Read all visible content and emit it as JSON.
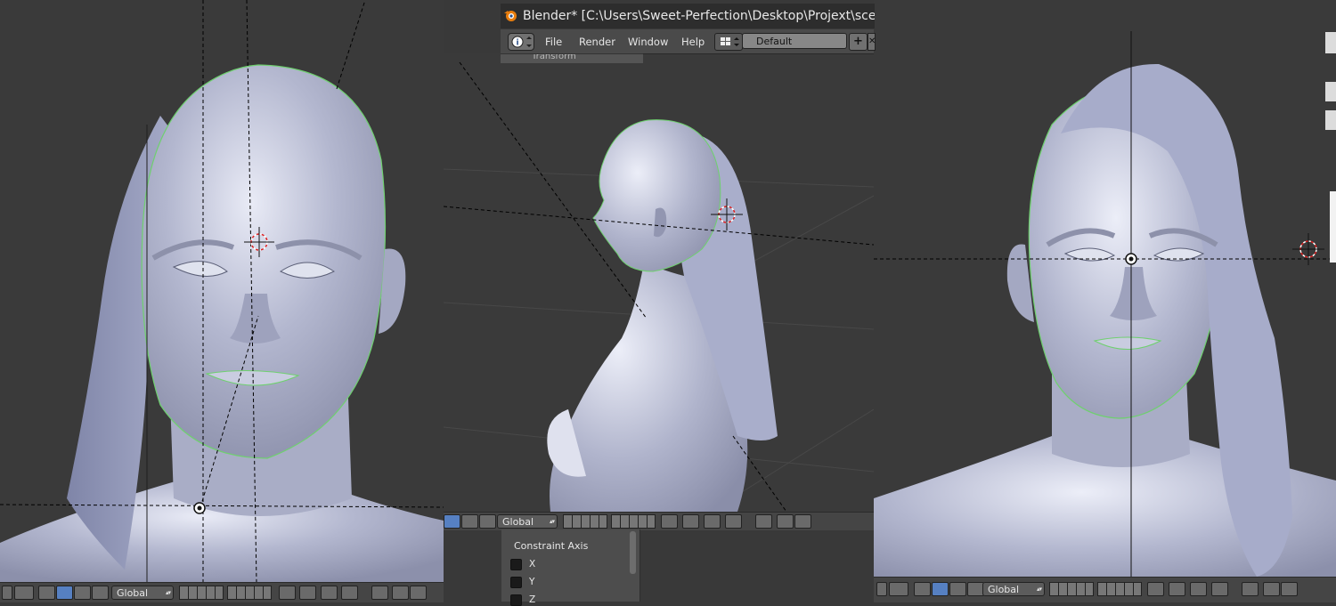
{
  "window": {
    "title": "Blender* [C:\\Users\\Sweet-Perfection\\Desktop\\Projext\\scenes\\lizzie.blend]"
  },
  "menu": {
    "items": [
      "File",
      "Render",
      "Window",
      "Help"
    ],
    "screen_layout": "Default"
  },
  "properties_panel": {
    "tab_label": "Transform"
  },
  "viewports": {
    "left": {
      "orientation": "Global"
    },
    "middle": {
      "orientation": "Global"
    },
    "right": {
      "orientation": "Global"
    }
  },
  "operator_panel": {
    "title": "Constraint Axis",
    "axes": [
      "X",
      "Y",
      "Z"
    ]
  },
  "colors": {
    "viewport_bg": "#3a3a3a",
    "header_bg": "#454545",
    "mesh": "#b9bdd3",
    "selection_outline": "#6fd06f",
    "active_button": "#5680c2"
  }
}
